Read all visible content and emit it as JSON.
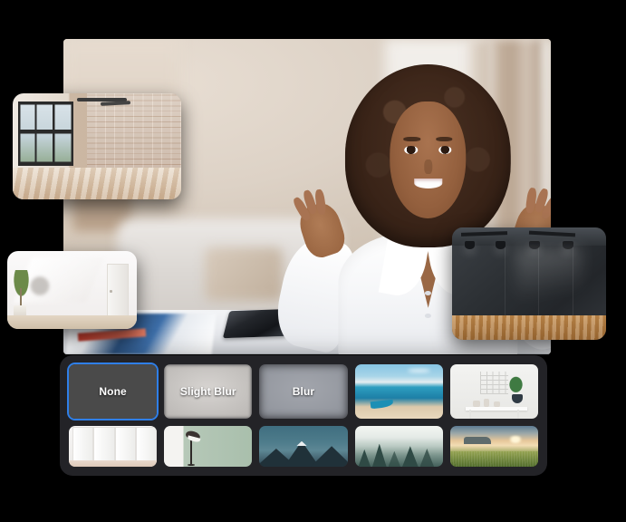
{
  "app": {
    "title": "Virtual Background Selector",
    "background_color": "#000000",
    "accent_color": "#2f7fe8",
    "panel_color": "#232327"
  },
  "video_preview": {
    "name": "video-preview",
    "description": "Woman with curly hair in white blouse gesturing at a desk",
    "scene": {
      "subject": "presenter",
      "desk_items": [
        "smartphone",
        "papers"
      ],
      "background": "blurred living room with sofa and curtains"
    }
  },
  "floating_previews": [
    {
      "id": "loft",
      "name": "loft-brick-room-preview",
      "label": "Loft with brick wall and large windows"
    },
    {
      "id": "white-room",
      "name": "white-room-preview",
      "label": "Bright white room with plant and sunlight"
    },
    {
      "id": "gallery",
      "name": "dark-gallery-preview",
      "label": "Dark gallery with spotlights and wood floor"
    }
  ],
  "selector": {
    "name": "background-selector-panel",
    "selected_index": 0,
    "columns": 5,
    "rows": 2,
    "items": [
      {
        "id": "none",
        "label": "None",
        "type": "effect",
        "selected": true
      },
      {
        "id": "slight-blur",
        "label": "Slight Blur",
        "type": "effect",
        "selected": false
      },
      {
        "id": "blur",
        "label": "Blur",
        "type": "effect",
        "selected": false
      },
      {
        "id": "beach",
        "label": "",
        "type": "image",
        "selected": false,
        "alt": "Beach with blue boat"
      },
      {
        "id": "shelf-room",
        "label": "",
        "type": "image",
        "selected": false,
        "alt": "White console table with plant"
      },
      {
        "id": "white-doors",
        "label": "",
        "type": "image",
        "selected": false,
        "alt": "White doors in empty room"
      },
      {
        "id": "lamp-wall",
        "label": "",
        "type": "image",
        "selected": false,
        "alt": "Floor lamp against green wall"
      },
      {
        "id": "mountains",
        "label": "",
        "type": "image",
        "selected": false,
        "alt": "Snowy mountain peaks"
      },
      {
        "id": "forest",
        "label": "",
        "type": "image",
        "selected": false,
        "alt": "Misty pine forest"
      },
      {
        "id": "sunset",
        "label": "",
        "type": "image",
        "selected": false,
        "alt": "Sunset over green hills"
      }
    ]
  }
}
